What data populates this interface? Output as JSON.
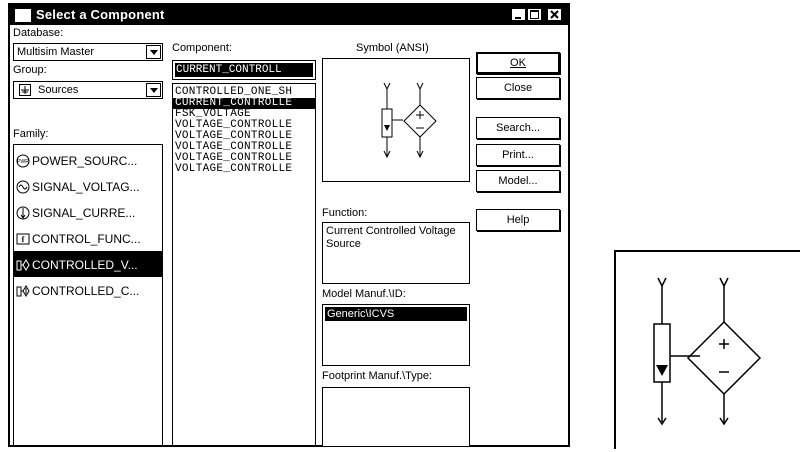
{
  "window": {
    "title": "Select a Component"
  },
  "database": {
    "label": "Database:",
    "value": "Multisim Master"
  },
  "group": {
    "label": "Group:",
    "value": "Sources"
  },
  "family": {
    "label": "Family:",
    "items": [
      {
        "label": "POWER_SOURC...",
        "icon": "power-source-icon"
      },
      {
        "label": "SIGNAL_VOLTAG...",
        "icon": "signal-voltage-icon"
      },
      {
        "label": "SIGNAL_CURRE...",
        "icon": "signal-current-icon"
      },
      {
        "label": "CONTROL_FUNC...",
        "icon": "control-function-icon"
      },
      {
        "label": "CONTROLLED_V...",
        "icon": "controlled-voltage-icon",
        "selected": true
      },
      {
        "label": "CONTROLLED_C...",
        "icon": "controlled-current-icon"
      }
    ]
  },
  "component": {
    "label": "Component:",
    "search_value": "CURRENT_CONTROLL",
    "items": [
      {
        "label": "CONTROLLED_ONE_SH"
      },
      {
        "label": "CURRENT_CONTROLLE",
        "selected": true
      },
      {
        "label": "FSK_VOLTAGE"
      },
      {
        "label": "VOLTAGE_CONTROLLE"
      },
      {
        "label": "VOLTAGE_CONTROLLE"
      },
      {
        "label": "VOLTAGE_CONTROLLE"
      },
      {
        "label": "VOLTAGE_CONTROLLE"
      },
      {
        "label": "VOLTAGE_CONTROLLE"
      }
    ]
  },
  "symbol": {
    "label": "Symbol (ANSI)"
  },
  "function": {
    "label": "Function:",
    "value": "Current Controlled Voltage Source"
  },
  "model": {
    "label": "Model Manuf.\\ID:",
    "selected_value": "Generic\\ICVS"
  },
  "footprint": {
    "label": "Footprint Manuf.\\Type:"
  },
  "buttons": {
    "ok": "OK",
    "close": "Close",
    "search": "Search...",
    "print": "Print...",
    "model": "Model...",
    "help": "Help"
  },
  "colors": {
    "selection": "#000000",
    "background": "#ffffff"
  }
}
